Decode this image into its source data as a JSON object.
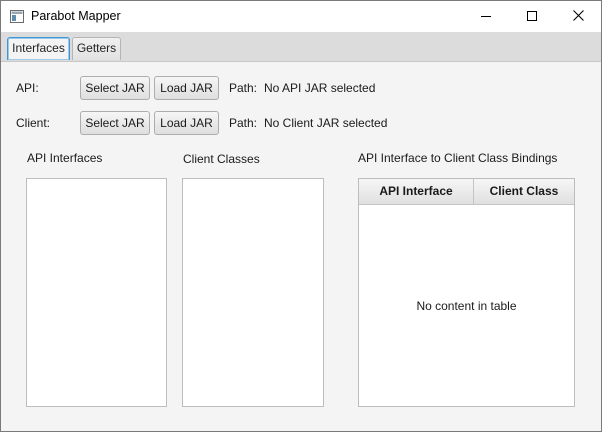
{
  "window": {
    "title": "Parabot Mapper"
  },
  "tabs": [
    {
      "label": "Interfaces",
      "active": true
    },
    {
      "label": "Getters",
      "active": false
    }
  ],
  "api_row": {
    "label": "API:",
    "select_button": "Select JAR",
    "load_button": "Load JAR",
    "path_label": "Path:",
    "path_value": "No API JAR selected"
  },
  "client_row": {
    "label": "Client:",
    "select_button": "Select JAR",
    "load_button": "Load JAR",
    "path_label": "Path:",
    "path_value": "No Client JAR selected"
  },
  "panels": {
    "api_interfaces": {
      "title": "API Interfaces",
      "items": []
    },
    "client_classes": {
      "title": "Client Classes",
      "items": []
    },
    "bindings": {
      "title": "API Interface to Client Class Bindings",
      "columns": [
        "API Interface",
        "Client Class"
      ],
      "rows": [],
      "empty_text": "No content in table"
    }
  },
  "colors": {
    "active_tab_border": "#3d97d6",
    "background": "#f4f4f4"
  }
}
